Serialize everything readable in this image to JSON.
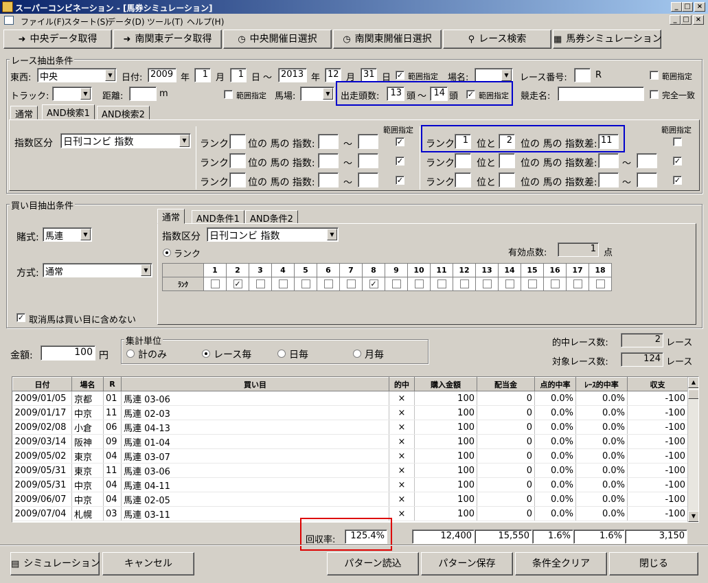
{
  "window": {
    "title": "スーパーコンビネーション - [馬券シミュレーション]",
    "btn_min": "_",
    "btn_max": "□",
    "btn_close": "×"
  },
  "menu": [
    "ファイル(F)",
    "スタート(S)",
    "データ(D)",
    "ツール(T)",
    "ヘルプ(H)"
  ],
  "toolbar": {
    "chuo_data": "中央データ取得",
    "nankanto_data": "南関東データ取得",
    "chuo_date": "中央開催日選択",
    "nankanto_date": "南関東開催日選択",
    "race_search": "レース検索",
    "baken_sim": "馬券シミュレーション"
  },
  "race": {
    "group_label": "レース抽出条件",
    "tozai_label": "東西:",
    "tozai_value": "中央",
    "date_label": "日付:",
    "year_from": "2009",
    "year_label": "年",
    "month_from": "1",
    "month_label": "月",
    "day_from": "1",
    "day_label": "日",
    "tilde": "～",
    "year_to": "2013",
    "month_to": "12",
    "day_to": "31",
    "range_label": "範囲指定",
    "basho_label": "場名:",
    "race_no_label": "レース番号:",
    "race_unit": "R",
    "track_label": "トラック:",
    "kyori_label": "距離:",
    "kyori_unit": "m",
    "baba_label": "馬場:",
    "tousu_label": "出走頭数:",
    "tousu_from": "13",
    "tousu_unit": "頭",
    "tousu_to": "14",
    "kyosou_label": "競走名:",
    "kanzen_label": "完全一致",
    "tabs": [
      "通常",
      "AND検索1",
      "AND検索2"
    ],
    "shisu_label": "指数区分",
    "shisu_value": "日刊コンビ 指数",
    "rank_label": "ランク",
    "rank_suffix": "位の 馬の 指数:",
    "rank2_mid": "位と",
    "rank2_suffix": "位の 馬の 指数差:",
    "diff_rank_a": "1",
    "diff_rank_b": "2",
    "diff_value": "11"
  },
  "bet": {
    "group_label": "買い目抽出条件",
    "shiki_label": "賭式:",
    "shiki_value": "馬連",
    "houshiki_label": "方式:",
    "houshiki_value": "通常",
    "torikeshi_label": "取消馬は買い目に含めない",
    "tabs": [
      "通常",
      "AND条件1",
      "AND条件2"
    ],
    "shisu_label": "指数区分",
    "shisu_value": "日刊コンビ 指数",
    "rank_radio": "ランク",
    "yukou_label": "有効点数:",
    "yukou_value": "1",
    "yukou_unit": "点",
    "rank_row_label": "ﾗﾝｸ",
    "rank_numbers": [
      "1",
      "2",
      "3",
      "4",
      "5",
      "6",
      "7",
      "8",
      "9",
      "10",
      "11",
      "12",
      "13",
      "14",
      "15",
      "16",
      "17",
      "18"
    ],
    "rank_checked": [
      false,
      true,
      false,
      false,
      false,
      false,
      false,
      true,
      false,
      false,
      false,
      false,
      false,
      false,
      false,
      false,
      false,
      false
    ]
  },
  "summary": {
    "kingaku_label": "金額:",
    "kingaku_value": "100",
    "kingaku_unit": "円",
    "shukei_label": "集計単位",
    "opt_total": "計のみ",
    "opt_race": "レース毎",
    "opt_day": "日毎",
    "opt_month": "月毎",
    "tekichu_label": "的中レース数:",
    "tekichu_value": "2",
    "race_unit": "レース",
    "taisho_label": "対象レース数:",
    "taisho_value": "124"
  },
  "grid": {
    "headers": [
      "日付",
      "場名",
      "R",
      "買い目",
      "的中",
      "購入金額",
      "配当金",
      "点的中率",
      "ﾚｰｽ的中率",
      "収支"
    ],
    "rows": [
      [
        "2009/01/05",
        "京都",
        "01",
        "馬連 03-06",
        "×",
        "100",
        "0",
        "0.0%",
        "0.0%",
        "-100"
      ],
      [
        "2009/01/17",
        "中京",
        "11",
        "馬連 02-03",
        "×",
        "100",
        "0",
        "0.0%",
        "0.0%",
        "-100"
      ],
      [
        "2009/02/08",
        "小倉",
        "06",
        "馬連 04-13",
        "×",
        "100",
        "0",
        "0.0%",
        "0.0%",
        "-100"
      ],
      [
        "2009/03/14",
        "阪神",
        "09",
        "馬連 01-04",
        "×",
        "100",
        "0",
        "0.0%",
        "0.0%",
        "-100"
      ],
      [
        "2009/05/02",
        "東京",
        "04",
        "馬連 03-07",
        "×",
        "100",
        "0",
        "0.0%",
        "0.0%",
        "-100"
      ],
      [
        "2009/05/31",
        "東京",
        "11",
        "馬連 03-06",
        "×",
        "100",
        "0",
        "0.0%",
        "0.0%",
        "-100"
      ],
      [
        "2009/05/31",
        "中京",
        "04",
        "馬連 04-11",
        "×",
        "100",
        "0",
        "0.0%",
        "0.0%",
        "-100"
      ],
      [
        "2009/06/07",
        "中京",
        "04",
        "馬連 02-05",
        "×",
        "100",
        "0",
        "0.0%",
        "0.0%",
        "-100"
      ],
      [
        "2009/07/04",
        "札幌",
        "03",
        "馬連 03-11",
        "×",
        "100",
        "0",
        "0.0%",
        "0.0%",
        "-100"
      ]
    ]
  },
  "totals": {
    "kaishu_label": "回収率:",
    "kaishu_value": "125.4%",
    "purchase": "12,400",
    "payout": "15,550",
    "point_hit": "1.6%",
    "race_hit": "1.6%",
    "balance": "3,150"
  },
  "footer": {
    "simulation": "シミュレーション",
    "cancel": "キャンセル",
    "pattern_load": "パターン読込",
    "pattern_save": "パターン保存",
    "clear_all": "条件全クリア",
    "close": "閉じる"
  },
  "highlight_colors": {
    "blue": "#0000cc",
    "red": "#dd0000"
  }
}
